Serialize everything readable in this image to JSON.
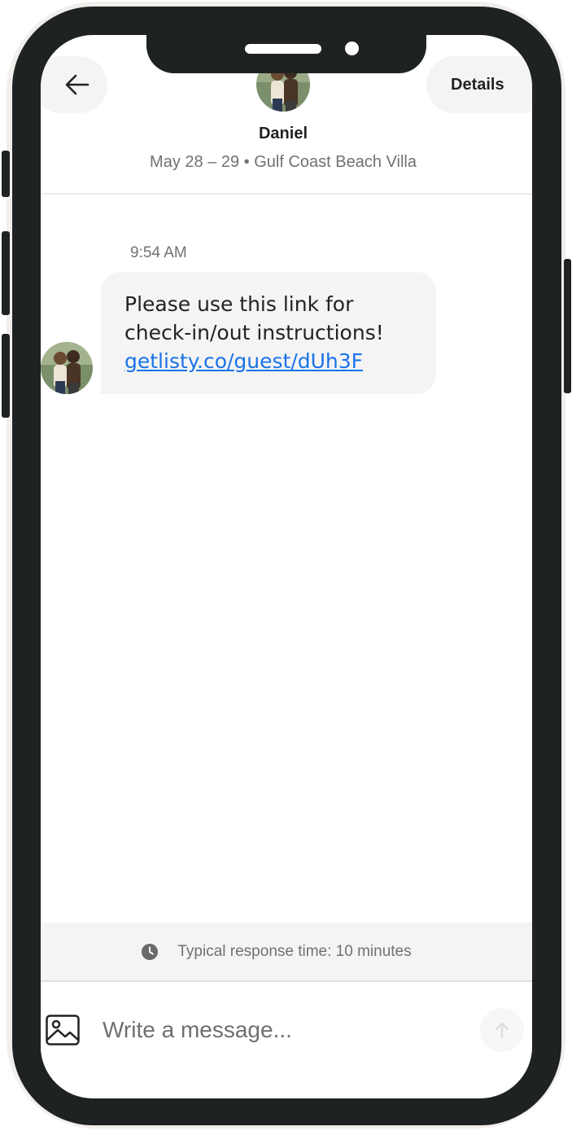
{
  "header": {
    "back_icon": "arrow-left-icon",
    "details_label": "Details",
    "host_name": "Daniel",
    "trip_info": "May 28 – 29 • Gulf Coast Beach Villa"
  },
  "thread": {
    "timestamp": "9:54 AM",
    "message": {
      "line1": "Please use this link for",
      "line2": "check-in/out instructions!",
      "link_text": "getlisty.co/guest/dUh3F"
    }
  },
  "response_time": {
    "icon": "clock-icon",
    "text": "Typical response time: 10 minutes"
  },
  "composer": {
    "image_icon": "image-icon",
    "placeholder": "Write a message...",
    "send_icon": "arrow-up-icon"
  },
  "colors": {
    "frame": "#1f2222",
    "bubble": "#f4f4f4",
    "link": "#1a73e8",
    "muted_text": "#717171"
  }
}
